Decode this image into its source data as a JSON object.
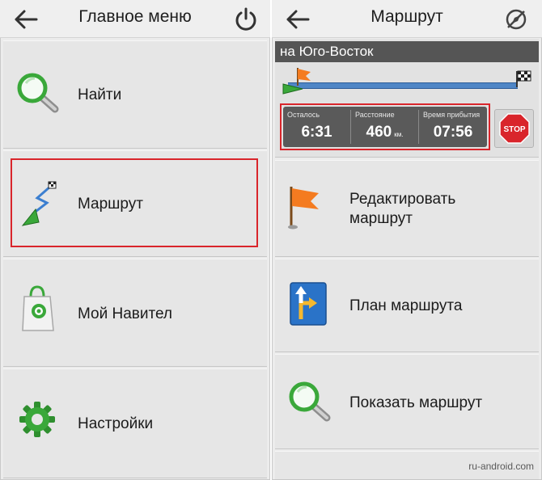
{
  "main_menu": {
    "title": "Главное меню",
    "items": [
      {
        "label": "Найти"
      },
      {
        "label": "Маршрут"
      },
      {
        "label": "Мой Навител"
      },
      {
        "label": "Настройки"
      }
    ]
  },
  "route_menu": {
    "title": "Маршрут",
    "direction": "на Юго-Восток",
    "summary": {
      "remaining_label": "Осталось",
      "remaining_value": "6:31",
      "distance_label": "Расстояние",
      "distance_value": "460",
      "distance_unit": "км.",
      "arrival_label": "Время прибытия",
      "arrival_value": "07:56"
    },
    "stop_label": "STOP",
    "items": [
      {
        "label_line1": "Редактировать",
        "label_line2": "маршрут"
      },
      {
        "label": "План маршрута"
      },
      {
        "label": "Показать маршрут"
      }
    ]
  },
  "watermark": "ru-android.com",
  "colors": {
    "highlight": "#d9252b",
    "direction_bar": "#555555",
    "progress": "#4f86c6",
    "icon_green": "#3aa83a",
    "flag_orange": "#f47b20"
  },
  "icons": {
    "back": "back-arrow-icon",
    "power": "power-icon",
    "compass_off": "compass-off-icon",
    "search": "magnifier-icon",
    "route": "route-icon",
    "shop": "shopping-bag-icon",
    "settings": "gear-icon",
    "edit_route": "orange-flag-icon",
    "route_plan": "turn-sign-icon",
    "show_route": "magnifier-icon",
    "stop": "stop-sign-icon"
  }
}
